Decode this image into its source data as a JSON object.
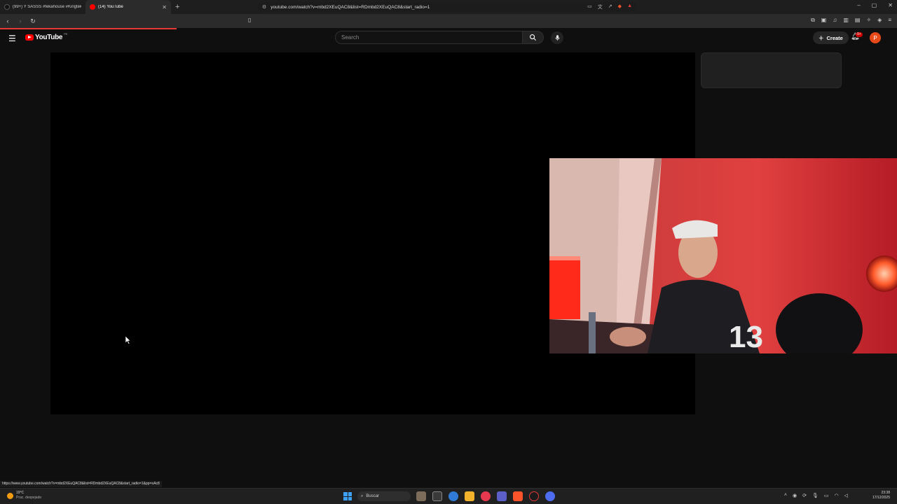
{
  "browser": {
    "tabs": [
      {
        "title": "(99+) Y SASSS #fekahouse #Kingteka",
        "active": false,
        "favicon_color": "#000000"
      },
      {
        "title": "(14) YouTube",
        "active": true,
        "favicon_color": "#ff0000"
      }
    ],
    "url": "youtube.com/watch?v=mbd2XEuQAC8&list=RDmbd2XEuQAC8&start_radio=1",
    "window_controls": [
      "–",
      "▢",
      "✕"
    ]
  },
  "youtube": {
    "logo_text": "YouTube",
    "country_code": "PE",
    "search_placeholder": "Search",
    "create_label": "Create",
    "notification_badge": "9+",
    "avatar_letter": "P"
  },
  "status_bar_url": "https://www.youtube.com/watch?v=mbd2XEuQAC8&list=RDmbd2XEuQAC8&start_radio=1&pp=oAc8",
  "taskbar": {
    "weather_temp": "19°C",
    "weather_desc": "Prac. despejado",
    "search_label": "Buscar",
    "time": "23:38",
    "date": "17/12/2025"
  },
  "colors": {
    "accent_red": "#ff0000",
    "page_bg": "#0f0f0f",
    "avatar_bg": "#e64a19"
  }
}
